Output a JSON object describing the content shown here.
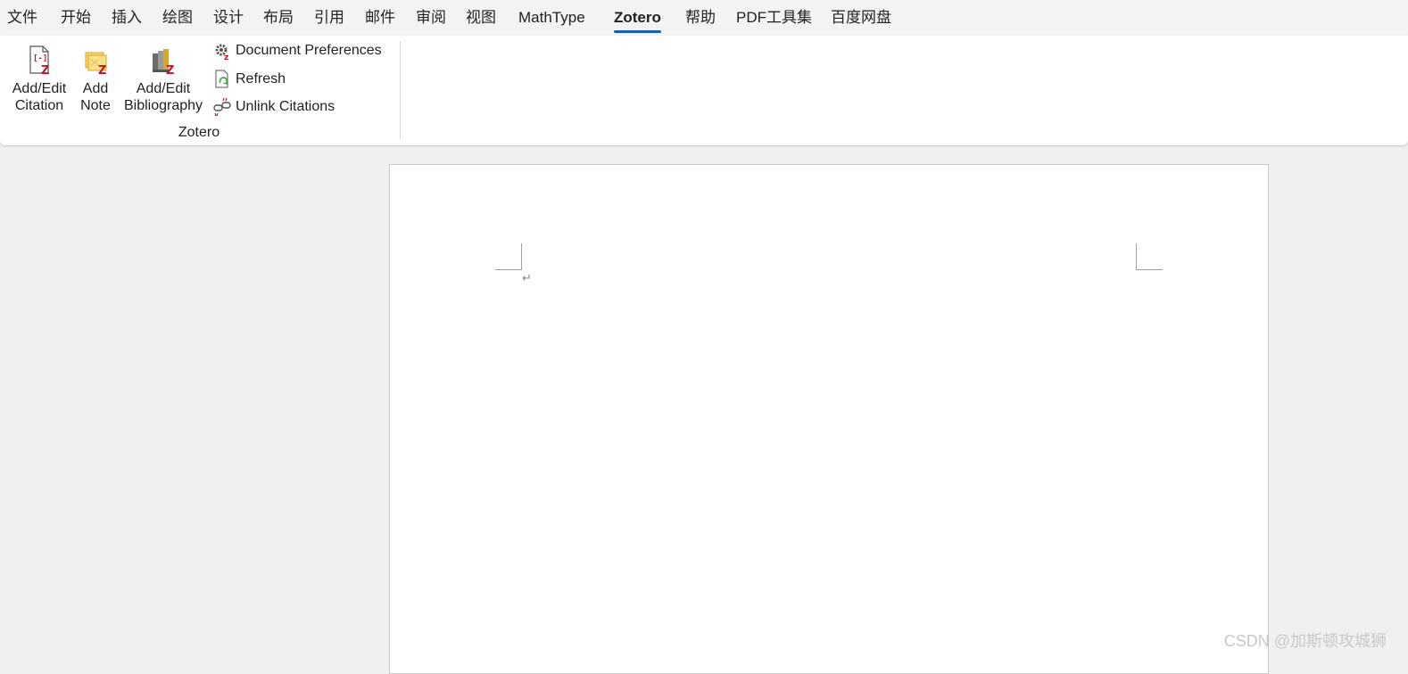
{
  "menu": {
    "tabs": [
      {
        "label": "文件"
      },
      {
        "label": "开始"
      },
      {
        "label": "插入"
      },
      {
        "label": "绘图"
      },
      {
        "label": "设计"
      },
      {
        "label": "布局"
      },
      {
        "label": "引用"
      },
      {
        "label": "邮件"
      },
      {
        "label": "审阅"
      },
      {
        "label": "视图"
      },
      {
        "label": "MathType"
      },
      {
        "label": "Zotero"
      },
      {
        "label": "帮助"
      },
      {
        "label": "PDF工具集"
      },
      {
        "label": "百度网盘"
      }
    ],
    "active_tab": "Zotero",
    "accent_color": "#1a5fb4"
  },
  "ribbon": {
    "group_label": "Zotero",
    "large_buttons": [
      {
        "line1": "Add/Edit",
        "line2": "Citation",
        "icon": "add-edit-citation-icon"
      },
      {
        "line1": "Add",
        "line2": "Note",
        "icon": "add-note-icon"
      },
      {
        "line1": "Add/Edit",
        "line2": "Bibliography",
        "icon": "add-edit-bibliography-icon"
      }
    ],
    "small_buttons": [
      {
        "label": "Document Preferences",
        "icon": "gear-icon"
      },
      {
        "label": "Refresh",
        "icon": "refresh-icon"
      },
      {
        "label": "Unlink Citations",
        "icon": "unlink-icon"
      }
    ],
    "zotero_color": "#c8102e"
  },
  "document": {
    "paragraph_mark": "↵"
  },
  "watermark": "CSDN @加斯顿攻城狮"
}
